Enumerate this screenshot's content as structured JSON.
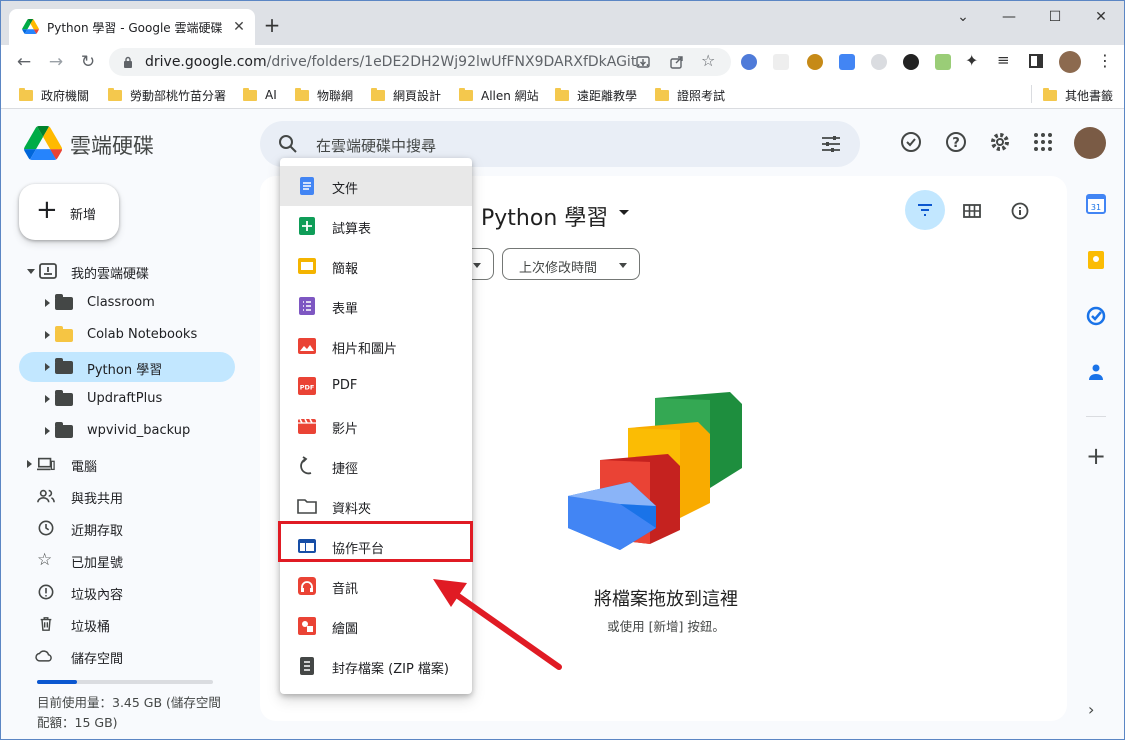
{
  "browser": {
    "tab_title": "Python 學習 - Google 雲端硬碟",
    "url_host": "drive.google.com",
    "url_path": "/drive/folders/1eDE2DH2Wj92lwUfFNX9DARXfDkAGit...",
    "bookmarks": [
      "政府機關",
      "勞動部桃竹苗分署",
      "AI",
      "物聯網",
      "網頁設計",
      "Allen 網站",
      "遠距離教學",
      "證照考試"
    ],
    "other_bookmarks": "其他書籤"
  },
  "drive": {
    "logo_text": "雲端硬碟",
    "search_placeholder": "在雲端硬碟中搜尋",
    "new_button": "新增",
    "nav": {
      "my_drive": "我的雲端硬碟",
      "folders": [
        "Classroom",
        "Colab Notebooks",
        "Python 學習",
        "UpdraftPlus",
        "wpvivid_backup"
      ],
      "computers": "電腦",
      "shared": "與我共用",
      "recent": "近期存取",
      "starred": "已加星號",
      "spam": "垃圾內容",
      "trash": "垃圾桶",
      "storage": "儲存空間"
    },
    "storage_used_text": "目前使用量：3.45 GB (儲存空間配額：15 GB)",
    "storage_fraction": 0.23,
    "main": {
      "heading": "Python 學習",
      "chip_modified": "上次修改時間",
      "drop_title": "將檔案拖放到這裡",
      "drop_subtitle": "或使用 [新增] 按鈕。"
    }
  },
  "menu": {
    "items": [
      "文件",
      "試算表",
      "簡報",
      "表單",
      "相片和圖片",
      "PDF",
      "影片",
      "捷徑",
      "資料夾",
      "協作平台",
      "音訊",
      "繪圖",
      "封存檔案 (ZIP 檔案)"
    ],
    "highlighted_item": "協作平台"
  },
  "colors": {
    "accent_blue": "#0b57d0",
    "selected_bg": "#c2e7ff",
    "highlight_red": "#e01b24"
  }
}
